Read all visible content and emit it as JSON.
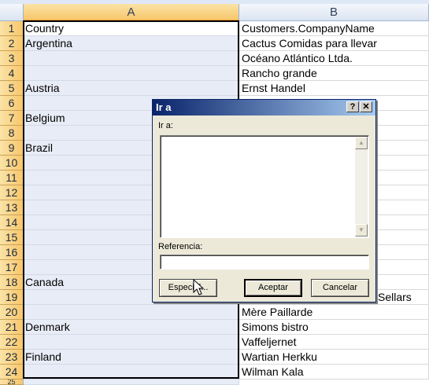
{
  "sheet": {
    "columns": [
      "A",
      "B"
    ],
    "rows": [
      {
        "num": "1",
        "a": "Country",
        "b": "Customers.CompanyName"
      },
      {
        "num": "2",
        "a": "Argentina",
        "b": "Cactus Comidas para llevar"
      },
      {
        "num": "3",
        "a": "",
        "b": "Océano Atlántico Ltda."
      },
      {
        "num": "4",
        "a": "",
        "b": "Rancho grande"
      },
      {
        "num": "5",
        "a": "Austria",
        "b": "Ernst Handel"
      },
      {
        "num": "6",
        "a": "",
        "b": ""
      },
      {
        "num": "7",
        "a": "Belgium",
        "b": ""
      },
      {
        "num": "8",
        "a": "",
        "b": ""
      },
      {
        "num": "9",
        "a": "Brazil",
        "b": ""
      },
      {
        "num": "10",
        "a": "",
        "b": ""
      },
      {
        "num": "11",
        "a": "",
        "b": ""
      },
      {
        "num": "12",
        "a": "",
        "b": ""
      },
      {
        "num": "13",
        "a": "",
        "b": ""
      },
      {
        "num": "14",
        "a": "",
        "b": ""
      },
      {
        "num": "15",
        "a": "",
        "b": ""
      },
      {
        "num": "16",
        "a": "",
        "b": ""
      },
      {
        "num": "17",
        "a": "",
        "b": ""
      },
      {
        "num": "18",
        "a": "Canada",
        "b": ""
      },
      {
        "num": "19",
        "a": "",
        "b": "Sellars"
      },
      {
        "num": "20",
        "a": "",
        "b": "Mère Paillarde"
      },
      {
        "num": "21",
        "a": "Denmark",
        "b": "Simons bistro"
      },
      {
        "num": "22",
        "a": "",
        "b": "Vaffeljernet"
      },
      {
        "num": "23",
        "a": "Finland",
        "b": "Wartian Herkku"
      },
      {
        "num": "24",
        "a": "",
        "b": "Wilman Kala"
      }
    ],
    "partial_row": "25"
  },
  "dialog": {
    "title": "Ir a",
    "help_label": "?",
    "close_label": "✕",
    "goto_label": "Ir a:",
    "reference_label": "Referencia:",
    "reference_value": "",
    "special_button": "Especial...",
    "ok_button": "Aceptar",
    "cancel_button": "Cancelar",
    "scroll_up": "▲",
    "scroll_down": "▼"
  },
  "colors": {
    "selected_header": "#f7c66b",
    "selected_column_fill": "#e8ecf6",
    "title_bar": "#0a246a"
  }
}
